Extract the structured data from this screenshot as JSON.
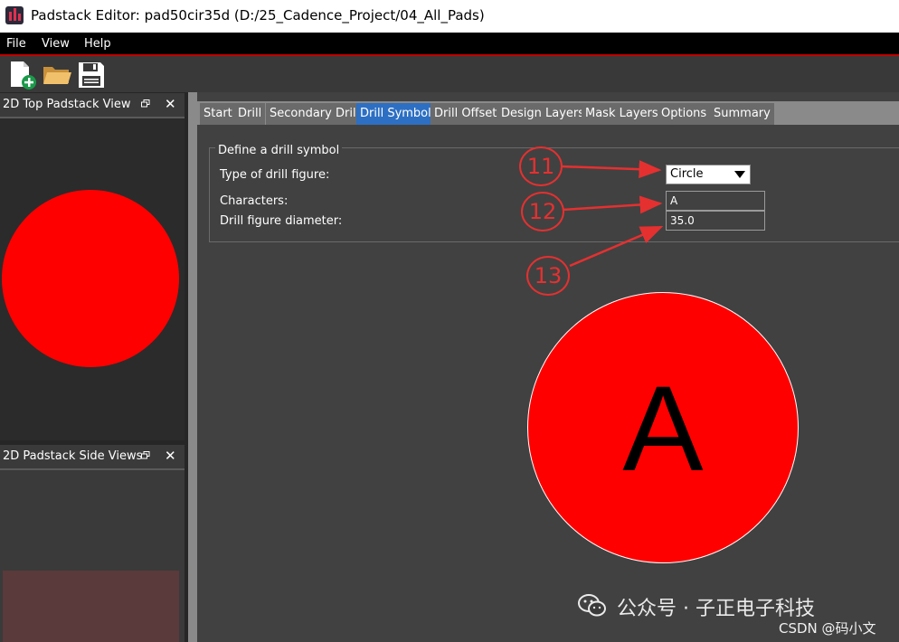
{
  "window": {
    "title": "Padstack Editor: pad50cir35d  (D:/25_Cadence_Project/04_All_Pads)"
  },
  "menu": {
    "items": [
      "File",
      "View",
      "Help"
    ]
  },
  "toolbar": {
    "icons": [
      "new-file-icon",
      "open-folder-icon",
      "save-icon"
    ]
  },
  "panels": {
    "top": {
      "title": "2D Top Padstack View"
    },
    "side": {
      "title": "2D Padstack Side Views"
    }
  },
  "tabs": [
    {
      "label": "Start"
    },
    {
      "label": "Drill"
    },
    {
      "label": "Secondary Drill"
    },
    {
      "label": "Drill Symbol",
      "active": true
    },
    {
      "label": "Drill Offset"
    },
    {
      "label": "Design Layers"
    },
    {
      "label": "Mask Layers"
    },
    {
      "label": "Options"
    },
    {
      "label": "Summary"
    }
  ],
  "drill_symbol": {
    "group_title": "Define a drill symbol",
    "type_label": "Type of drill figure:",
    "type_value": "Circle",
    "characters_label": "Characters:",
    "characters_value": "A",
    "diameter_label": "Drill figure diameter:",
    "diameter_value": "35.0"
  },
  "annotations": [
    "11",
    "12",
    "13"
  ],
  "preview": {
    "character": "A"
  },
  "colors": {
    "accent": "#2d6fc3",
    "pad": "#ff0000",
    "annotation": "#e53030"
  },
  "watermark": {
    "text": "公众号 · 子正电子科技",
    "credit": "CSDN @码小文"
  }
}
